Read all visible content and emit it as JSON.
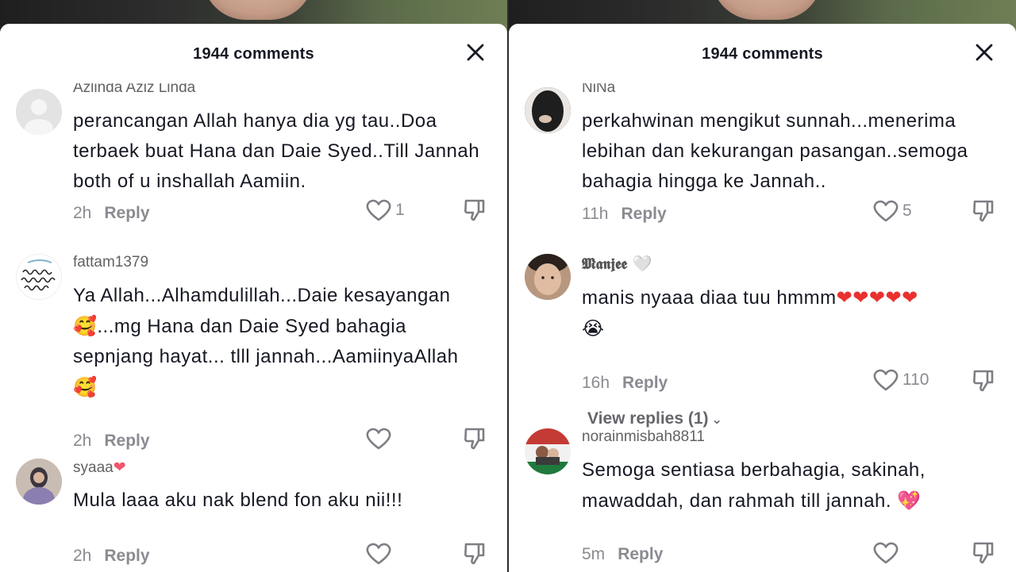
{
  "left": {
    "header": {
      "count": "1944 comments"
    },
    "comments": [
      {
        "username": "Azlinda Aziz Linda",
        "text": "perancangan Allah hanya dia yg tau..Doa terbaek buat Hana dan Daie Syed..Till Jannah both of u inshallah Aamiin.",
        "time": "2h",
        "reply": "Reply",
        "likes": "1"
      },
      {
        "username": "fattam1379",
        "text_line1": "Ya Allah...Alhamdulillah...Daie kesayangan",
        "emoji_a": "🥰",
        "text_line2": "...mg Hana dan Daie Syed bahagia",
        "text_line3": "sepnjang hayat... tlll jannah...AamiinyaAllah",
        "emoji_b": "🥰",
        "time": "2h",
        "reply": "Reply",
        "likes": ""
      },
      {
        "username": "syaaa",
        "username_emoji": "❤",
        "text": "Mula laaa aku nak blend fon aku nii!!!",
        "time": "2h",
        "reply": "Reply",
        "likes": ""
      }
    ]
  },
  "right": {
    "header": {
      "count": "1944 comments"
    },
    "comments": [
      {
        "username": "NiNa",
        "text": "perkahwinan mengikut sunnah...menerima lebihan dan kekurangan pasangan..semoga bahagia hingga ke Jannah..",
        "time": "11h",
        "reply": "Reply",
        "likes": "5"
      },
      {
        "username": "𝕸𝖆𝖓𝖏𝖊𝖊",
        "username_emoji": "🤍",
        "text": "manis nyaaa diaa tuu hmmm",
        "hearts": "❤❤❤❤❤",
        "emoji_b": "😭",
        "time": "16h",
        "reply": "Reply",
        "likes": "110",
        "view_replies": "View replies (1)"
      },
      {
        "username": "norainmisbah8811",
        "text": "Semoga sentiasa berbahagia, sakinah, mawaddah, dan rahmah till jannah.",
        "emoji_b": "💖",
        "time": "5m",
        "reply": "Reply",
        "likes": ""
      }
    ]
  },
  "icons": {
    "close": "close-icon",
    "like": "heart-outline-icon",
    "dislike": "thumbs-down-icon",
    "chevron": "chevron-down-icon"
  },
  "colors": {
    "text": "#161823",
    "muted": "#8a8b91",
    "heart": "#e8312f",
    "sheet": "#ffffff"
  }
}
